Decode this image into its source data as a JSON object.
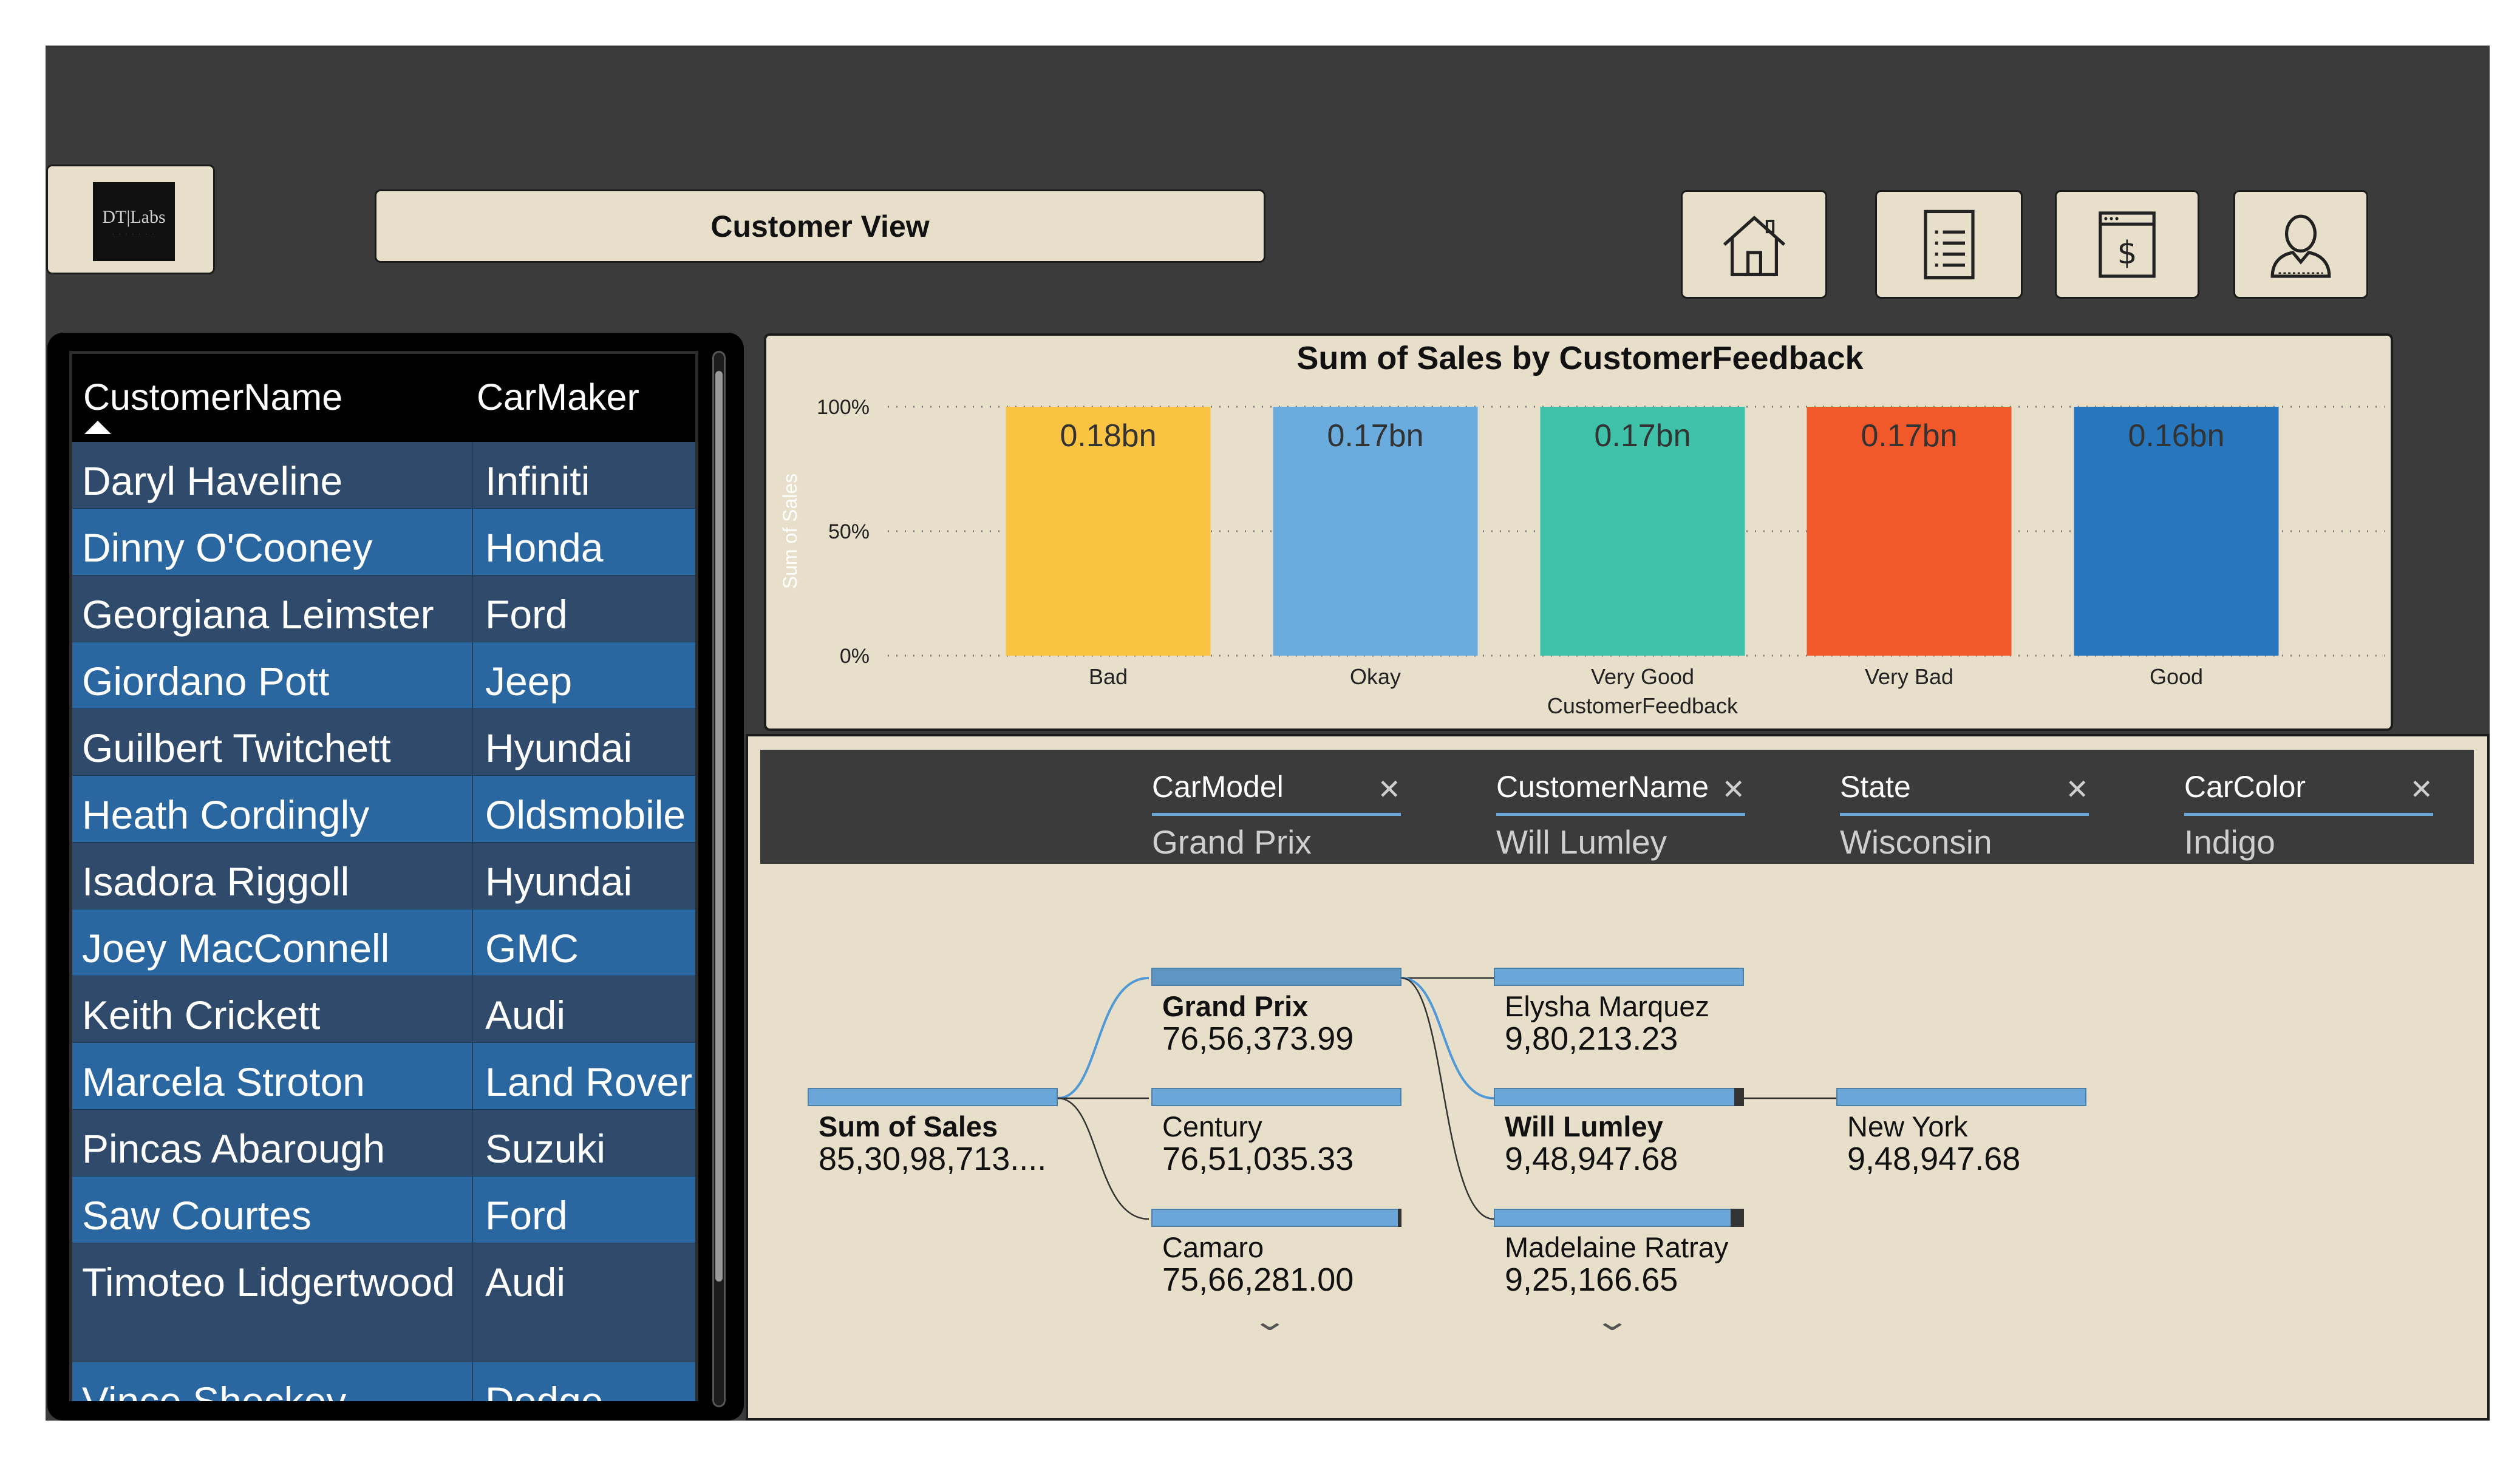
{
  "header": {
    "logo_text": "DT|Labs",
    "title": "Customer View",
    "nav": [
      "home-icon",
      "report-list-icon",
      "sales-dollar-icon",
      "customer-profile-icon"
    ]
  },
  "table": {
    "columns": [
      "CustomerName",
      "CarMaker"
    ],
    "sort": "CustomerName ascending",
    "rows": [
      {
        "name": "Daryl Haveline",
        "maker": "Infiniti"
      },
      {
        "name": "Dinny O'Cooney",
        "maker": "Honda"
      },
      {
        "name": "Georgiana Leimster",
        "maker": "Ford"
      },
      {
        "name": "Giordano Pott",
        "maker": "Jeep"
      },
      {
        "name": "Guilbert Twitchett",
        "maker": "Hyundai"
      },
      {
        "name": "Heath Cordingly",
        "maker": "Oldsmobile"
      },
      {
        "name": "Isadora Riggoll",
        "maker": "Hyundai"
      },
      {
        "name": "Joey MacConnell",
        "maker": "GMC"
      },
      {
        "name": "Keith Crickett",
        "maker": "Audi"
      },
      {
        "name": "Marcela Stroton",
        "maker": "Land Rover"
      },
      {
        "name": "Pincas Abarough",
        "maker": "Suzuki"
      },
      {
        "name": "Saw Courtes",
        "maker": "Ford"
      },
      {
        "name": "Timoteo Lidgertwood",
        "maker": "Audi"
      },
      {
        "name": "Vince Sheckey",
        "maker": "Dodge"
      }
    ]
  },
  "chart_data": {
    "type": "bar",
    "title": "Sum of Sales by CustomerFeedback",
    "xlabel": "CustomerFeedback",
    "ylabel": "Sum of Sales",
    "categories": [
      "Bad",
      "Okay",
      "Very Good",
      "Very Bad",
      "Good"
    ],
    "values": [
      100,
      100,
      100,
      100,
      100
    ],
    "data_labels": [
      "0.18bn",
      "0.17bn",
      "0.17bn",
      "0.17bn",
      "0.16bn"
    ],
    "colors": [
      "#fbc342",
      "#6aacdd",
      "#3ec2aa",
      "#f1592a",
      "#2677bd"
    ],
    "yticks": [
      "0%",
      "50%",
      "100%"
    ],
    "ylim": [
      0,
      100
    ],
    "grid": true
  },
  "filters": [
    {
      "label": "CarModel",
      "value": "Grand Prix"
    },
    {
      "label": "CustomerName",
      "value": "Will Lumley"
    },
    {
      "label": "State",
      "value": "Wisconsin"
    },
    {
      "label": "CarColor",
      "value": "Indigo"
    }
  ],
  "tree": {
    "root": {
      "label": "Sum of Sales",
      "value": "85,30,98,713...."
    },
    "level1": [
      {
        "label": "Grand Prix",
        "value": "76,56,373.99"
      },
      {
        "label": "Century",
        "value": "76,51,035.33"
      },
      {
        "label": "Camaro",
        "value": "75,66,281.00"
      }
    ],
    "level2": [
      {
        "label": "Elysha Marquez",
        "value": "9,80,213.23"
      },
      {
        "label": "Will Lumley",
        "value": "9,48,947.68"
      },
      {
        "label": "Madelaine Ratray",
        "value": "9,25,166.65"
      }
    ],
    "level3": [
      {
        "label": "New York",
        "value": "9,48,947.68"
      }
    ]
  }
}
